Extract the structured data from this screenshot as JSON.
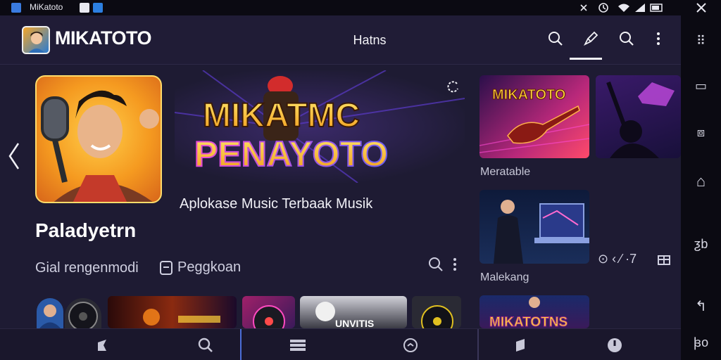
{
  "status_bar": {
    "title": "MiKatoto"
  },
  "header": {
    "app_title": "MIKATOTO",
    "center_label": "Hatns",
    "icons": [
      "search-icon",
      "brush-icon",
      "search-icon",
      "more-vertical-icon"
    ]
  },
  "featured": {
    "app_name": "Paladyetrn",
    "subtitle_left": "Gial rengenmodi",
    "subtitle_right": "Peggkoan",
    "banner_line1": "MIKATMC",
    "banner_line2": "PENAYOTO",
    "description": "Aplokase Music Terbaak Musik"
  },
  "right_column": {
    "thumb1_text": "MIKATOTO",
    "label1": "Meratable",
    "label2": "Malekang",
    "stats_text": "⊙ ‹ ⁄ ·7",
    "thumb_bottom_text": "MIKATOTNS"
  },
  "bottom_strip": {
    "card_text": "UNVITIS"
  },
  "nav_rail": {
    "items": [
      "⠿",
      "▭",
      "⧈",
      "⌂",
      "ƺb",
      "↰",
      "ꟓo"
    ]
  },
  "colors": {
    "background": "#1e1b33",
    "header_bg": "#201c36",
    "bar_bg": "#0b0a12",
    "accent_yellow": "#f6c330",
    "accent_purple": "#9a4bd6"
  }
}
